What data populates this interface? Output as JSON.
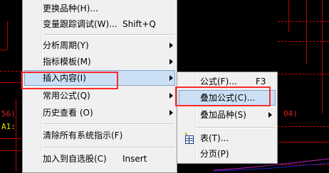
{
  "background": {
    "left_label_1": "56)",
    "left_label_2": "A1:",
    "right_label": "04)",
    "colors": {
      "background": "#000000",
      "chart_lines": "#b80000",
      "label_red": "#e02020",
      "label_yellow": "#f0e000"
    }
  },
  "main_menu": {
    "items": [
      {
        "label": "更换品种(H)...",
        "shortcut": "",
        "submenu": false
      },
      {
        "label": "变量跟踪调试(W)...",
        "shortcut": "Shift+Q",
        "submenu": false
      },
      {
        "label": "分析周期(Y)",
        "shortcut": "",
        "submenu": true
      },
      {
        "label": "指标模板(M)",
        "shortcut": "",
        "submenu": true
      },
      {
        "label": "插入内容(I)",
        "shortcut": "",
        "submenu": true,
        "highlighted": true
      },
      {
        "label": "常用公式(Q)",
        "shortcut": "",
        "submenu": true
      },
      {
        "label": "历史查看 (O)",
        "shortcut": "",
        "submenu": true
      },
      {
        "label": "清除所有系统指示(F)",
        "shortcut": "",
        "submenu": false
      },
      {
        "label": "加入到自选股(C)",
        "shortcut": "Insert",
        "submenu": false
      }
    ]
  },
  "sub_menu": {
    "items": [
      {
        "label": "公式(F)...",
        "shortcut": "F3",
        "submenu": false,
        "icon": ""
      },
      {
        "label": "叠加公式(C)...",
        "shortcut": "",
        "submenu": false,
        "highlighted": true,
        "icon": ""
      },
      {
        "label": "叠加品种(S)",
        "shortcut": "",
        "submenu": true,
        "icon": ""
      },
      {
        "label": "表(T)...",
        "shortcut": "",
        "submenu": false,
        "icon": "table-icon"
      },
      {
        "label": "分页(P)",
        "shortcut": "",
        "submenu": false,
        "icon": ""
      }
    ]
  },
  "annotation_color": "#ff2a2a",
  "highlight_color": "#cce0f5"
}
